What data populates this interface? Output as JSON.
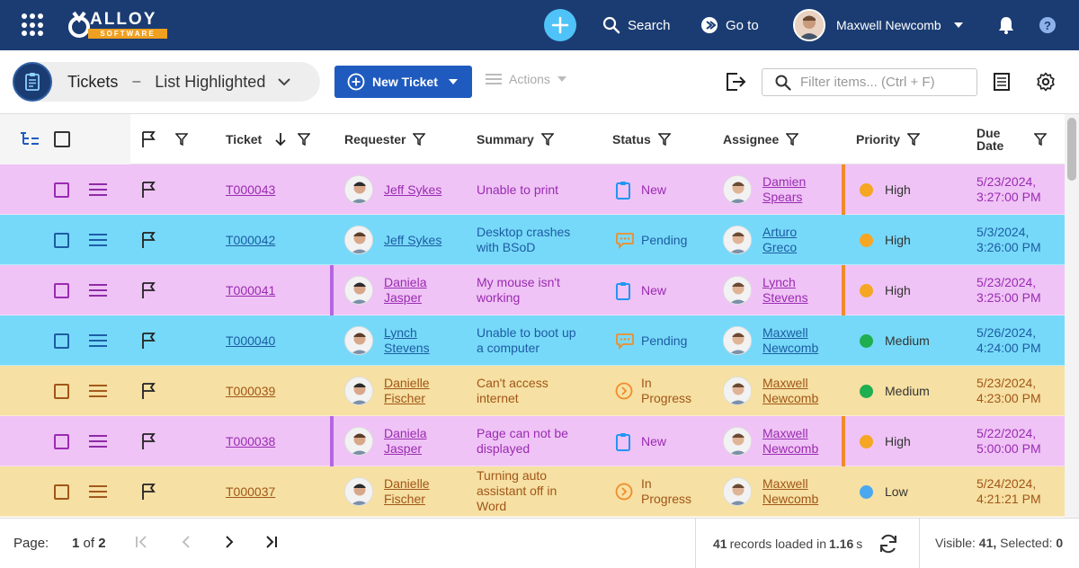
{
  "topbar": {
    "logo_text": "ALLOY",
    "logo_sub": "SOFTWARE",
    "search_label": "Search",
    "goto_label": "Go to",
    "user_name": "Maxwell Newcomb"
  },
  "toolbar": {
    "view_title": "Tickets",
    "view_dash": "–",
    "view_name": "List Highlighted",
    "new_ticket_label": "New Ticket",
    "actions_label": "Actions",
    "filter_placeholder": "Filter items... (Ctrl + F)"
  },
  "columns": {
    "ticket": "Ticket",
    "requester": "Requester",
    "summary": "Summary",
    "status": "Status",
    "assignee": "Assignee",
    "priority": "Priority",
    "due_line1": "Due",
    "due_line2": "Date"
  },
  "rows": [
    {
      "ticket": "T000043",
      "req1": "Jeff Sykes",
      "req2": "",
      "sum1": "Unable to print",
      "sum2": "",
      "sum3": "",
      "status1": "New",
      "status2": "",
      "asg1": "Damien",
      "asg2": "Spears",
      "priority": "High",
      "due1": "5/23/2024,",
      "due2": "3:27:00 PM"
    },
    {
      "ticket": "T000042",
      "req1": "Jeff Sykes",
      "req2": "",
      "sum1": "Desktop crashes",
      "sum2": "with BSoD",
      "sum3": "",
      "status1": "Pending",
      "status2": "",
      "asg1": "Arturo",
      "asg2": "Greco",
      "priority": "High",
      "due1": "5/3/2024,",
      "due2": "3:26:00 PM"
    },
    {
      "ticket": "T000041",
      "req1": "Daniela",
      "req2": "Jasper",
      "sum1": "My mouse isn't",
      "sum2": "working",
      "sum3": "",
      "status1": "New",
      "status2": "",
      "asg1": "Lynch",
      "asg2": "Stevens",
      "priority": "High",
      "due1": "5/23/2024,",
      "due2": "3:25:00 PM"
    },
    {
      "ticket": "T000040",
      "req1": "Lynch",
      "req2": "Stevens",
      "sum1": "Unable to boot up",
      "sum2": "a computer",
      "sum3": "",
      "status1": "Pending",
      "status2": "",
      "asg1": "Maxwell",
      "asg2": "Newcomb",
      "priority": "Medium",
      "due1": "5/26/2024,",
      "due2": "4:24:00 PM"
    },
    {
      "ticket": "T000039",
      "req1": "Danielle",
      "req2": "Fischer",
      "sum1": "Can't access",
      "sum2": "internet",
      "sum3": "",
      "status1": "In",
      "status2": "Progress",
      "asg1": "Maxwell",
      "asg2": "Newcomb",
      "priority": "Medium",
      "due1": "5/23/2024,",
      "due2": "4:23:00 PM"
    },
    {
      "ticket": "T000038",
      "req1": "Daniela",
      "req2": "Jasper",
      "sum1": "Page can not be",
      "sum2": "displayed",
      "sum3": "",
      "status1": "New",
      "status2": "",
      "asg1": "Maxwell",
      "asg2": "Newcomb",
      "priority": "High",
      "due1": "5/22/2024,",
      "due2": "5:00:00 PM"
    },
    {
      "ticket": "T000037",
      "req1": "Danielle",
      "req2": "Fischer",
      "sum1": "Turning auto",
      "sum2": "assistant off in",
      "sum3": "Word",
      "status1": "In",
      "status2": "Progress",
      "asg1": "Maxwell",
      "asg2": "Newcomb",
      "priority": "Low",
      "due1": "5/24/2024,",
      "due2": "4:21:21 PM"
    }
  ],
  "colors": {
    "pink": "#efc3f5",
    "blue": "#77d9f9",
    "yellow": "#f6e0a3",
    "priority_high": "#f5a623",
    "priority_medium": "#1fae50",
    "priority_low": "#4aa8f0",
    "accent": "#1f5bbf"
  },
  "footer": {
    "page_label": "Page:",
    "page_current": "1",
    "page_of": "of",
    "page_total": "2",
    "records_count": "41",
    "records_text": "records loaded in",
    "records_time": "1.16",
    "records_unit": "s",
    "visible_label": "Visible:",
    "visible_count": "41,",
    "selected_label": "Selected:",
    "selected_count": "0"
  }
}
